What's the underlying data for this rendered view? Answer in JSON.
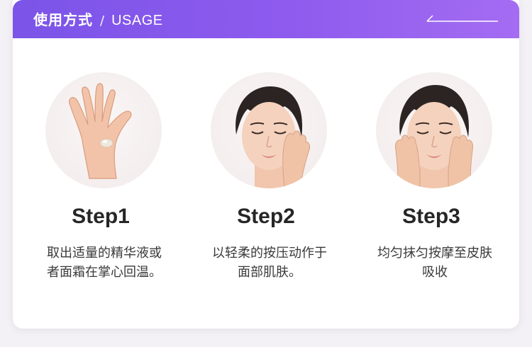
{
  "header": {
    "title_cn": "使用方式",
    "separator": "/",
    "title_en": "USAGE",
    "gradient_start": "#7b54e8",
    "gradient_end": "#a46cf2"
  },
  "steps": [
    {
      "title": "Step1",
      "desc": "取出适量的精华液或者面霜在掌心回温。",
      "photo": "hand-with-cream-icon"
    },
    {
      "title": "Step2",
      "desc": "以轻柔的按压动作于面部肌肤。",
      "photo": "face-one-hand-press-icon"
    },
    {
      "title": "Step3",
      "desc": "均匀抹匀按摩至皮肤吸收",
      "photo": "face-two-hands-massage-icon"
    }
  ]
}
